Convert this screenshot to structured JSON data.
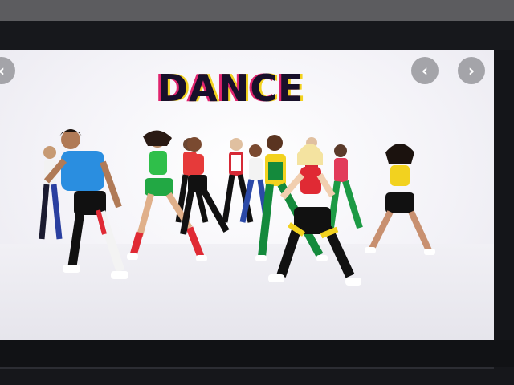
{
  "viewer": {
    "title_logo": "DANCE",
    "prev_icon": "‹",
    "next_icon": "›"
  },
  "colors": {
    "brand_pink": "#e0246e",
    "brand_yellow": "#f2d21f",
    "frame_dark": "#16171b"
  }
}
